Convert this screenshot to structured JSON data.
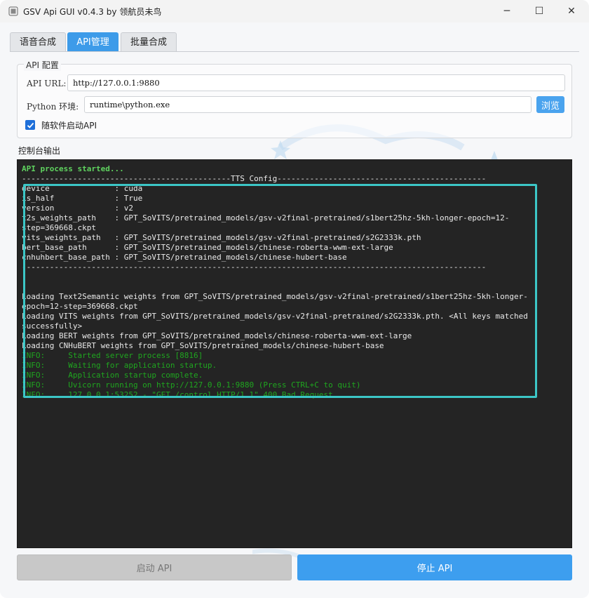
{
  "window": {
    "title": "GSV Api GUI v0.4.3   by  领航员未鸟",
    "minimize_glyph": "─",
    "maximize_glyph": "☐",
    "close_glyph": "✕"
  },
  "tabs": [
    {
      "label": "语音合成",
      "active": false
    },
    {
      "label": "API管理",
      "active": true
    },
    {
      "label": "批量合成",
      "active": false
    }
  ],
  "api_config": {
    "group_title": "API 配置",
    "url_label": "API URL:",
    "url_value": "http://127.0.0.1:9880",
    "python_label": "Python 环境:",
    "python_value": "runtime\\python.exe",
    "browse_label": "浏览",
    "autostart_checked": true,
    "autostart_label": "随软件启动API"
  },
  "console": {
    "label": "控制台输出",
    "lines": [
      {
        "text": "API process started...",
        "style": "ok"
      },
      {
        "text": "---------------------------------------------TTS Config---------------------------------------------",
        "style": "normal"
      },
      {
        "text": "device              : cuda",
        "style": "normal"
      },
      {
        "text": "is_half             : True",
        "style": "normal"
      },
      {
        "text": "version             : v2",
        "style": "normal"
      },
      {
        "text": "t2s_weights_path    : GPT_SoVITS/pretrained_models/gsv-v2final-pretrained/s1bert25hz-5kh-longer-epoch=12-",
        "style": "normal"
      },
      {
        "text": "step=369668.ckpt",
        "style": "normal"
      },
      {
        "text": "vits_weights_path   : GPT_SoVITS/pretrained_models/gsv-v2final-pretrained/s2G2333k.pth",
        "style": "normal"
      },
      {
        "text": "bert_base_path      : GPT_SoVITS/pretrained_models/chinese-roberta-wwm-ext-large",
        "style": "normal"
      },
      {
        "text": "cnhuhbert_base_path : GPT_SoVITS/pretrained_models/chinese-hubert-base",
        "style": "normal"
      },
      {
        "text": "----------------------------------------------------------------------------------------------------",
        "style": "normal"
      },
      {
        "text": "",
        "style": "normal"
      },
      {
        "text": "",
        "style": "normal"
      },
      {
        "text": "Loading Text2Semantic weights from GPT_SoVITS/pretrained_models/gsv-v2final-pretrained/s1bert25hz-5kh-longer-",
        "style": "normal"
      },
      {
        "text": "epoch=12-step=369668.ckpt",
        "style": "normal"
      },
      {
        "text": "Loading VITS weights from GPT_SoVITS/pretrained_models/gsv-v2final-pretrained/s2G2333k.pth. <All keys matched",
        "style": "normal"
      },
      {
        "text": "successfully>",
        "style": "normal"
      },
      {
        "text": "Loading BERT weights from GPT_SoVITS/pretrained_models/chinese-roberta-wwm-ext-large",
        "style": "normal"
      },
      {
        "text": "Loading CNHuBERT weights from GPT_SoVITS/pretrained_models/chinese-hubert-base",
        "style": "normal"
      },
      {
        "text": "INFO:     Started server process [8816]",
        "style": "info"
      },
      {
        "text": "INFO:     Waiting for application startup.",
        "style": "info"
      },
      {
        "text": "INFO:     Application startup complete.",
        "style": "info"
      },
      {
        "text": "INFO:     Uvicorn running on http://127.0.0.1:9880 (Press CTRL+C to quit)",
        "style": "info"
      },
      {
        "text": "INFO:     127.0.0.1:53252 - \"GET /control HTTP/1.1\" 400 Bad Request",
        "style": "info"
      }
    ]
  },
  "buttons": {
    "start_label": "启动 API",
    "stop_label": "停止 API"
  }
}
